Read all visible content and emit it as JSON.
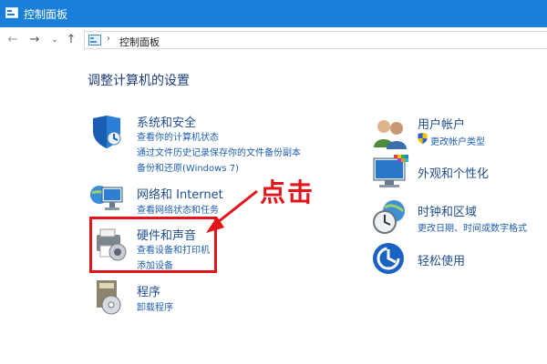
{
  "window": {
    "title": "控制面板"
  },
  "address": {
    "crumb": "控制面板"
  },
  "page": {
    "title": "调整计算机的设置"
  },
  "left": [
    {
      "title": "系统和安全",
      "links": [
        "查看你的计算机状态",
        "通过文件历史记录保存你的文件备份副本",
        "备份和还原(Windows 7)"
      ]
    },
    {
      "title": "网络和 Internet",
      "links": [
        "查看网络状态和任务"
      ]
    },
    {
      "title": "硬件和声音",
      "links": [
        "查看设备和打印机",
        "添加设备"
      ]
    },
    {
      "title": "程序",
      "links": [
        "卸载程序"
      ]
    }
  ],
  "right": [
    {
      "title": "用户帐户",
      "links": [
        "更改帐户类型"
      ]
    },
    {
      "title": "外观和个性化",
      "links": []
    },
    {
      "title": "时钟和区域",
      "links": [
        "更改日期、时间或数字格式"
      ]
    },
    {
      "title": "轻松使用",
      "links": []
    }
  ],
  "annotation": {
    "text": "点击",
    "color": "#e3141a"
  },
  "colors": {
    "titlebar": "#1a7fd8",
    "link": "#1f5fb0",
    "heading": "#1f4e8c"
  }
}
